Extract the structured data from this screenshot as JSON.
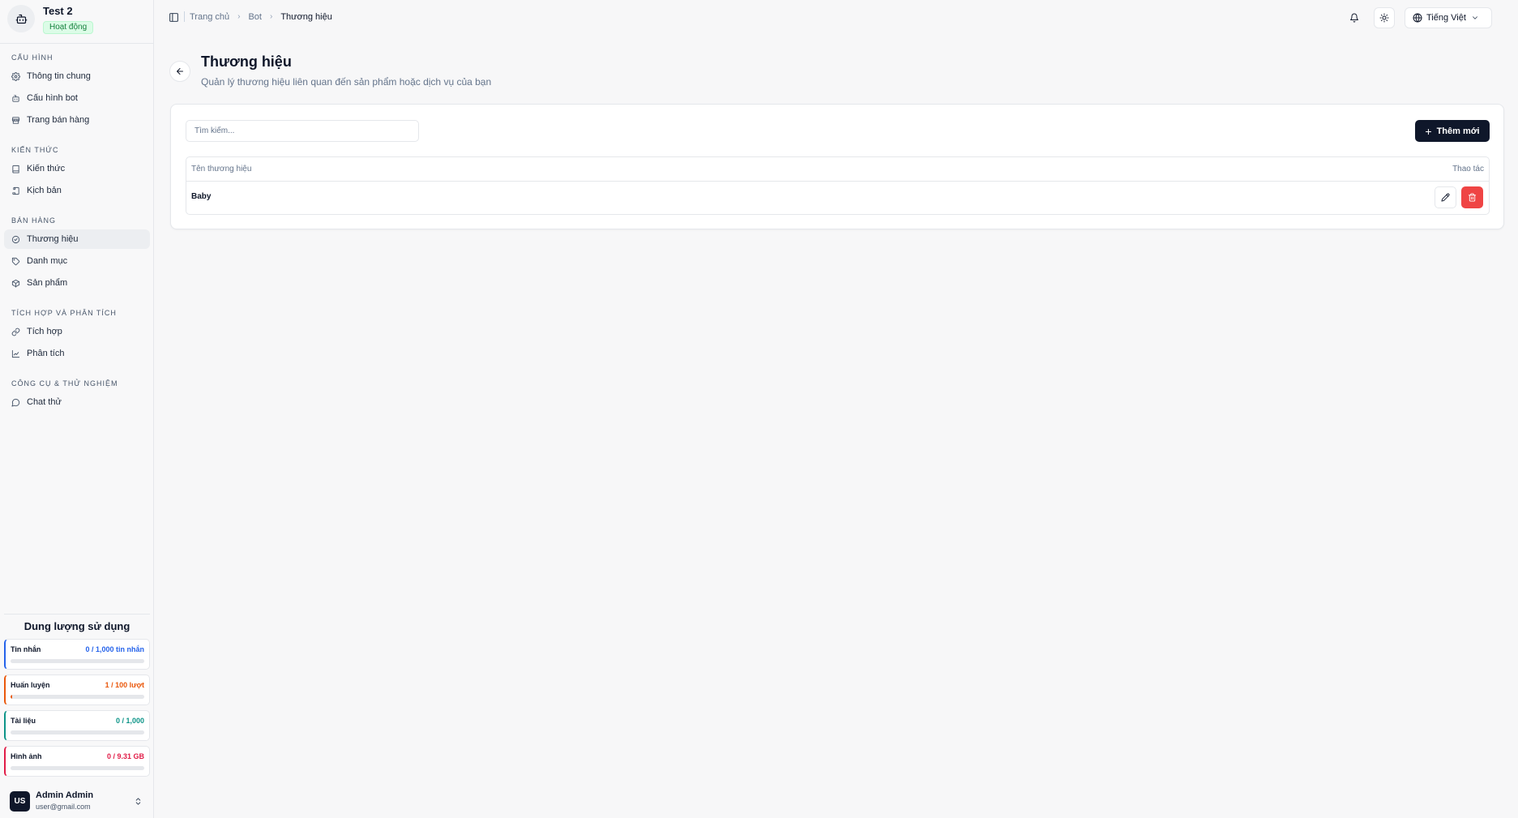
{
  "sidebar": {
    "bot": {
      "name": "Test 2",
      "status": "Hoạt động"
    },
    "sections": [
      {
        "title": "Cấu hình",
        "items": [
          {
            "label": "Thông tin chung",
            "icon": "gear-icon"
          },
          {
            "label": "Cấu hình bot",
            "icon": "bot-icon"
          },
          {
            "label": "Trang bán hàng",
            "icon": "store-icon"
          }
        ]
      },
      {
        "title": "Kiến thức",
        "items": [
          {
            "label": "Kiến thức",
            "icon": "book-icon"
          },
          {
            "label": "Kịch bản",
            "icon": "script-icon"
          }
        ]
      },
      {
        "title": "Bán hàng",
        "items": [
          {
            "label": "Thương hiệu",
            "icon": "badge-check-icon",
            "active": true
          },
          {
            "label": "Danh mục",
            "icon": "tag-icon"
          },
          {
            "label": "Sản phẩm",
            "icon": "package-icon"
          }
        ]
      },
      {
        "title": "Tích hợp và phân tích",
        "items": [
          {
            "label": "Tích hợp",
            "icon": "link-icon"
          },
          {
            "label": "Phân tích",
            "icon": "chart-line-icon"
          }
        ]
      },
      {
        "title": "Công cụ & thử nghiệm",
        "items": [
          {
            "label": "Chat thử",
            "icon": "chat-icon"
          }
        ]
      }
    ],
    "usage": {
      "title": "Dung lượng sử dụng",
      "items": [
        {
          "label": "Tin nhắn",
          "value": "0 / 1,000 tin nhắn",
          "fraction": 0,
          "color": "#2563eb"
        },
        {
          "label": "Huấn luyện",
          "value": "1 / 100 lượt",
          "fraction": 0.01,
          "color": "#ea580c"
        },
        {
          "label": "Tài liệu",
          "value": "0 / 1,000",
          "fraction": 0,
          "color": "#0d9488"
        },
        {
          "label": "Hình ảnh",
          "value": "0 / 9.31 GB",
          "fraction": 0,
          "color": "#e11d48"
        }
      ]
    },
    "user": {
      "initials": "US",
      "name": "Admin Admin",
      "email": "user@gmail.com"
    }
  },
  "topbar": {
    "breadcrumbs": [
      "Trang chủ",
      "Bot",
      "Thương hiệu"
    ],
    "language": "Tiếng Việt"
  },
  "page": {
    "title": "Thương hiệu",
    "subtitle": "Quản lý thương hiệu liên quan đến sản phẩm hoặc dịch vụ của bạn",
    "search_placeholder": "Tìm kiếm...",
    "add_label": "Thêm mới",
    "table": {
      "columns": [
        "Tên thương hiệu",
        "Thao tác"
      ],
      "rows": [
        {
          "name": "Baby"
        }
      ]
    }
  },
  "colors": {
    "primary": "#0f172a",
    "danger": "#ef4444",
    "active_status": "#15803d"
  }
}
